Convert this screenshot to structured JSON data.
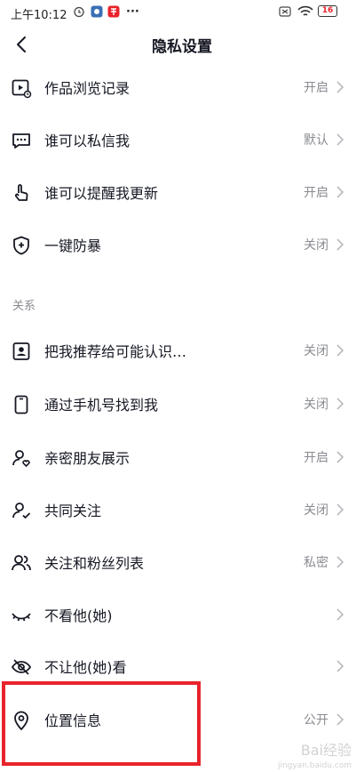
{
  "status_bar": {
    "time": "上午10:12",
    "more": "···",
    "battery": "16"
  },
  "header": {
    "title": "隐私设置"
  },
  "rows": [
    {
      "label": "作品浏览记录",
      "value": "开启"
    },
    {
      "label": "谁可以私信我",
      "value": "默认"
    },
    {
      "label": "谁可以提醒我更新",
      "value": "开启"
    },
    {
      "label": "一键防暴",
      "value": "关闭"
    }
  ],
  "section": {
    "title": "关系"
  },
  "relation_rows": [
    {
      "label": "把我推荐给可能认识…",
      "value": "关闭"
    },
    {
      "label": "通过手机号找到我",
      "value": "关闭"
    },
    {
      "label": "亲密朋友展示",
      "value": "开启"
    },
    {
      "label": "共同关注",
      "value": "关闭"
    },
    {
      "label": "关注和粉丝列表",
      "value": "私密"
    },
    {
      "label": "不看他(她)",
      "value": ""
    },
    {
      "label": "不让他(她)看",
      "value": ""
    },
    {
      "label": "位置信息",
      "value": "公开"
    }
  ],
  "watermark": {
    "main": "Bai经验",
    "sub": "jingyan.baidu.com"
  },
  "icons": {
    "back": "back-arrow-icon",
    "rows": [
      "video-history-icon",
      "message-icon",
      "finger-tap-icon",
      "shield-plus-icon"
    ],
    "relation_rows": [
      "contact-card-icon",
      "phone-icon",
      "user-heart-icon",
      "user-check-icon",
      "users-icon",
      "closed-eye-icon",
      "eye-slash-icon",
      "location-pin-icon"
    ]
  },
  "colors": {
    "highlight": "#e8232b",
    "value_text": "#8a8b91",
    "label_text": "#161823"
  }
}
